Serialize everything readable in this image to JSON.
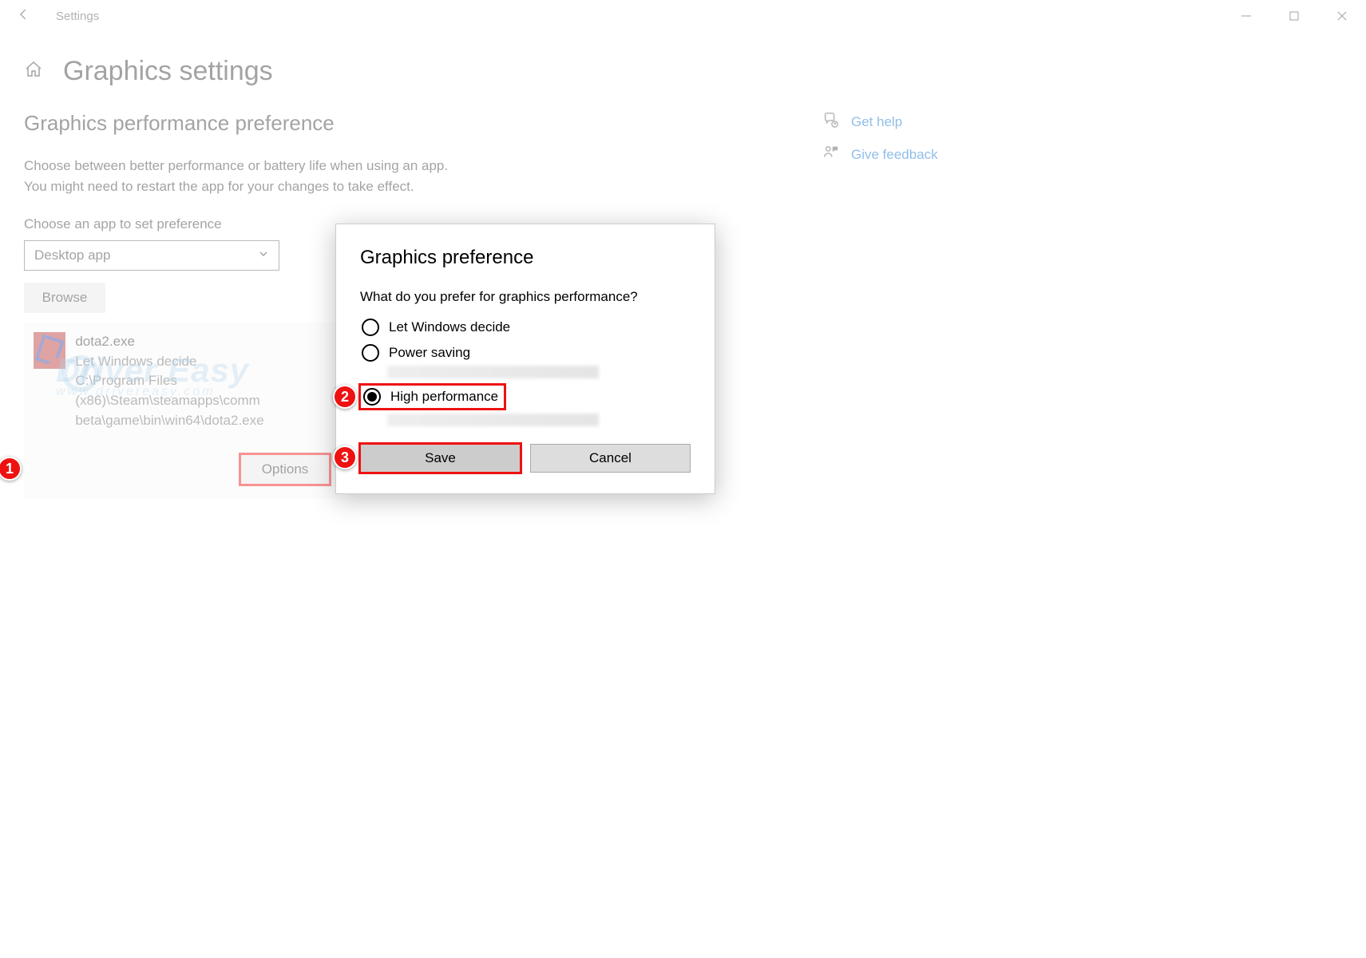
{
  "titlebar": {
    "title": "Settings"
  },
  "header": {
    "page_title": "Graphics settings"
  },
  "section": {
    "title": "Graphics performance preference",
    "desc1": "Choose between better performance or battery life when using an app.",
    "desc2": "You might need to restart the app for your changes to take effect.",
    "choose_label": "Choose an app to set preference",
    "select_value": "Desktop app",
    "browse": "Browse"
  },
  "app": {
    "name": "dota2.exe",
    "pref": "Let Windows decide",
    "path1": "C:\\Program Files (x86)\\Steam\\steamapps\\comm",
    "path2": "beta\\game\\bin\\win64\\dota2.exe",
    "options": "Options"
  },
  "annotations": {
    "b1": "1",
    "b2": "2",
    "b3": "3"
  },
  "dialog": {
    "title": "Graphics preference",
    "question": "What do you prefer for graphics performance?",
    "r1": "Let Windows decide",
    "r2": "Power saving",
    "r3": "High performance",
    "save": "Save",
    "cancel": "Cancel"
  },
  "side": {
    "help": "Get help",
    "feedback": "Give feedback"
  },
  "watermark": {
    "brand": "Driver Easy",
    "sub": "www.drivereasy.com"
  }
}
